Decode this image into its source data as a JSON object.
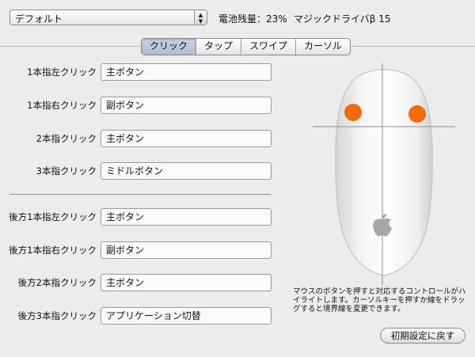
{
  "header": {
    "profile_select": {
      "value": "デフォルト",
      "arrow_icon": "updown-arrows-icon"
    },
    "battery_label": "電池残量：23%",
    "device_label": "マジックドライバβ 15"
  },
  "tabs": [
    {
      "label": "クリック",
      "active": true
    },
    {
      "label": "タップ",
      "active": false
    },
    {
      "label": "スワイプ",
      "active": false
    },
    {
      "label": "カーソル",
      "active": false
    }
  ],
  "front_rows": [
    {
      "label": "1本指左クリック",
      "value": "主ボタン"
    },
    {
      "label": "1本指右クリック",
      "value": "副ボタン"
    },
    {
      "label": "2本指クリック",
      "value": "主ボタン"
    },
    {
      "label": "3本指クリック",
      "value": "ミドルボタン"
    }
  ],
  "back_rows": [
    {
      "label": "後方1本指左クリック",
      "value": "主ボタン"
    },
    {
      "label": "後方1本指右クリック",
      "value": "副ボタン"
    },
    {
      "label": "後方2本指クリック",
      "value": "主ボタン"
    },
    {
      "label": "後方3本指クリック",
      "value": "アプリケーション切替"
    }
  ],
  "mouse_figure": {
    "logo_icon": "apple-logo-icon",
    "highlight_color": "#f26b0c"
  },
  "help_text": "マウスのボタンを押すと対応するコントロールがハイライトします。カーソルキーを押すか線をドラッグすると境界線を変更できます。",
  "reset_button_label": "初期設定に戻す"
}
